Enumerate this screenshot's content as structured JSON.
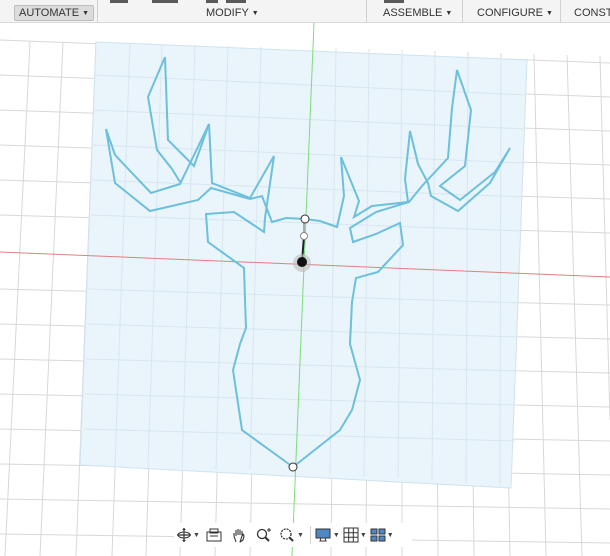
{
  "toolbar": {
    "automate_label": "AUTOMATE",
    "modify_label": "MODIFY",
    "assemble_label": "ASSEMBLE",
    "configure_label": "CONFIGURE",
    "construct_label": "CONST"
  },
  "colors": {
    "sketch_line": "#6cc0dc",
    "sketch_plane": "#e9f4fb",
    "grid_line": "#d6d6d6",
    "y_axis": "#7ddc7d",
    "x_axis": "#e08080"
  },
  "navbar": {
    "icons": [
      "orbit-icon",
      "look-at-icon",
      "pan-icon",
      "zoom-icon",
      "fit-icon",
      "display-settings-icon",
      "grid-settings-icon",
      "viewports-icon"
    ]
  }
}
